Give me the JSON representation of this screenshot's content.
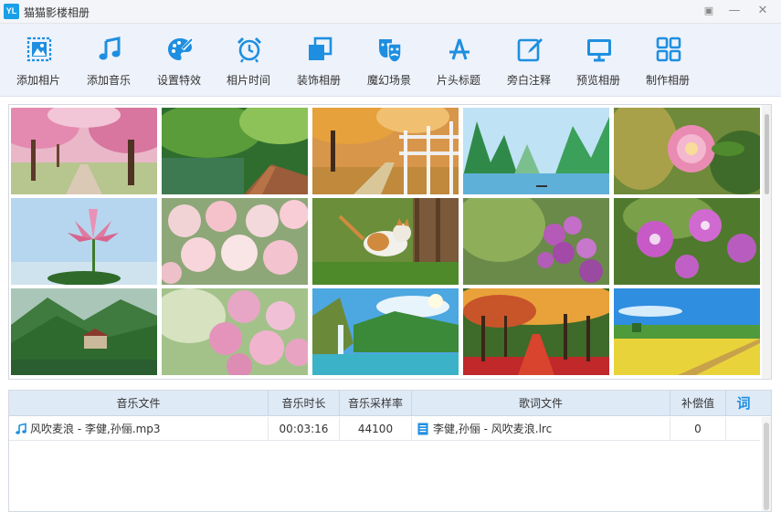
{
  "window": {
    "title": "猫猫影楼相册",
    "logo": "YL"
  },
  "toolbar": {
    "items": [
      {
        "label": "添加相片",
        "icon": "add-photo-icon"
      },
      {
        "label": "添加音乐",
        "icon": "music-note-icon"
      },
      {
        "label": "设置特效",
        "icon": "palette-icon"
      },
      {
        "label": "相片时间",
        "icon": "alarm-clock-icon"
      },
      {
        "label": "装饰相册",
        "icon": "layers-icon"
      },
      {
        "label": "魔幻场景",
        "icon": "theater-mask-icon"
      },
      {
        "label": "片头标题",
        "icon": "app-store-a-icon"
      },
      {
        "label": "旁白注释",
        "icon": "edit-pencil-icon"
      },
      {
        "label": "预览相册",
        "icon": "monitor-icon"
      },
      {
        "label": "制作相册",
        "icon": "grid-icon"
      }
    ]
  },
  "gallery": {
    "photos": [
      {
        "subject": "cherry-blossom-path"
      },
      {
        "subject": "forest-boardwalk"
      },
      {
        "subject": "autumn-fence-path"
      },
      {
        "subject": "karst-mountain-lake"
      },
      {
        "subject": "pink-rose-closeup"
      },
      {
        "subject": "pink-lotus-sky"
      },
      {
        "subject": "white-pink-roses"
      },
      {
        "subject": "kitten-on-grass"
      },
      {
        "subject": "purple-flowers"
      },
      {
        "subject": "pink-lilies"
      },
      {
        "subject": "green-valley-village"
      },
      {
        "subject": "pink-peonies"
      },
      {
        "subject": "waterfall-lake"
      },
      {
        "subject": "red-autumn-forest"
      },
      {
        "subject": "yellow-flower-field"
      }
    ]
  },
  "music_table": {
    "headers": {
      "file": "音乐文件",
      "duration": "音乐时长",
      "sample_rate": "音乐采样率",
      "lyric_file": "歌词文件",
      "offset": "补偿值",
      "lyric_button": "词"
    },
    "rows": [
      {
        "file": "风吹麦浪 - 李健,孙俪.mp3",
        "duration": "00:03:16",
        "sample_rate": "44100",
        "lyric_file": "李健,孙俪 - 风吹麦浪.lrc",
        "offset": "0"
      }
    ]
  },
  "colors": {
    "accent": "#1e8fe0",
    "toolbar_bg": "#eef2fb",
    "header_bg": "#dfeaf7"
  }
}
